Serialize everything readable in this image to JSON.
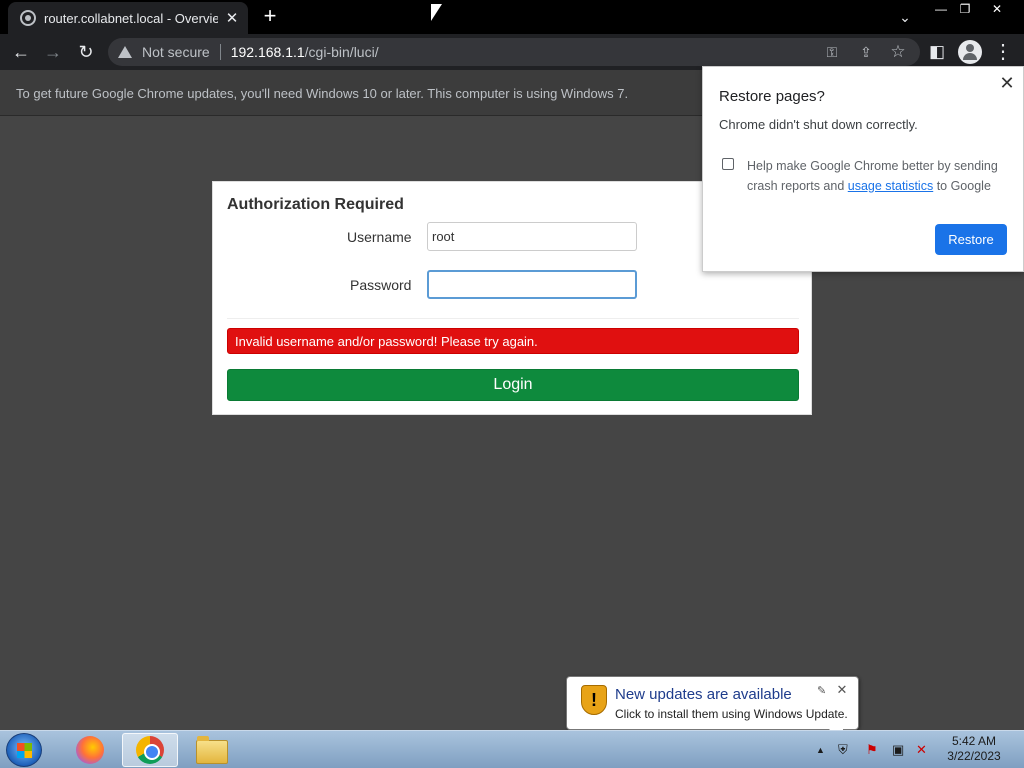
{
  "tab": {
    "title": "router.collabnet.local - Overview",
    "close": "✕"
  },
  "newtab": "+",
  "window": {
    "minimize": "—",
    "restore": "❐",
    "close": "✕"
  },
  "toolbar": {
    "back": "←",
    "forward": "→",
    "reload": "↻"
  },
  "omnibox": {
    "security": "Not secure",
    "host": "192.168.1.1",
    "path": "/cgi-bin/luci/"
  },
  "omnibox_icons": {
    "key": "⚿",
    "share": "⇪",
    "star": "☆"
  },
  "sidepanel": "◧",
  "menu": "⋮",
  "infobar": {
    "text": "To get future Google Chrome updates, you'll need Windows 10 or later. This computer is using Windows 7."
  },
  "login": {
    "title": "Authorization Required",
    "username_label": "Username",
    "username_value": "root",
    "password_label": "Password",
    "password_value": "",
    "error": "Invalid username and/or password! Please try again.",
    "login_button": "Login"
  },
  "restore_popup": {
    "title": "Restore pages?",
    "message": "Chrome didn't shut down correctly.",
    "checkbox_text_pre": "Help make Google Chrome better by sending crash reports and ",
    "checkbox_link": "usage statistics",
    "checkbox_text_post": " to Google",
    "button": "Restore",
    "close": "✕"
  },
  "balloon": {
    "title": "New updates are available",
    "subtitle": "Click to install them using Windows Update.",
    "icon_glyph": "!",
    "pin": "✎",
    "close": "✕"
  },
  "taskbar": {
    "apps": [
      "Firefox",
      "Chrome",
      "Windows Explorer"
    ],
    "tray_arrow": "▲",
    "clock_time": "5:42 AM",
    "clock_date": "3/22/2023"
  },
  "colors": {
    "error": "#e01010",
    "login_green": "#0e8a3d",
    "restore_blue": "#1a73e8"
  }
}
